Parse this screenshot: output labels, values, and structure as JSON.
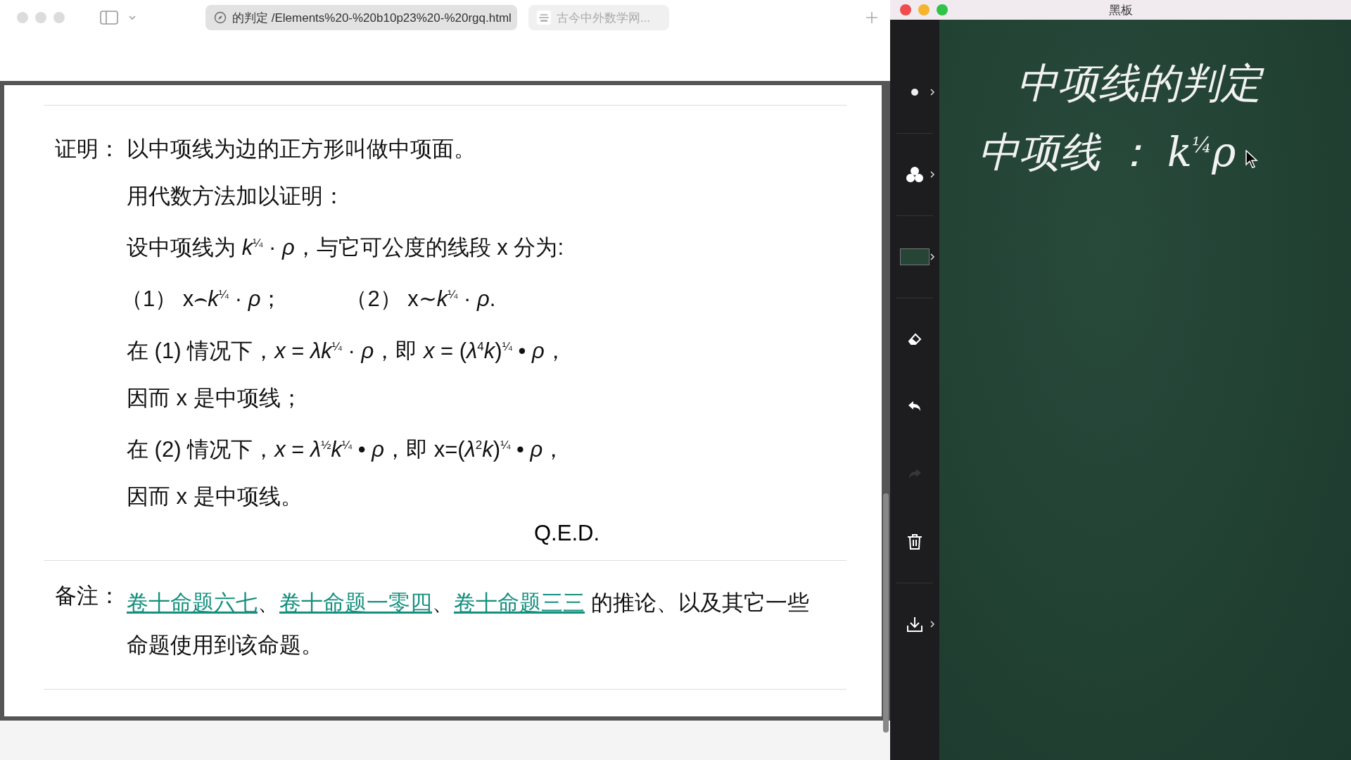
{
  "browser": {
    "tabs": [
      {
        "title": "的判定 /Elements%20-%20b10p23%20-%20rgq.html",
        "selected": true
      },
      {
        "title": "古今中外数学网...",
        "selected": false
      }
    ]
  },
  "page": {
    "proof": {
      "label": "证明：",
      "lines": [
        {
          "kind": "text",
          "text": "以中项线为边的正方形叫做中项面。"
        },
        {
          "kind": "text",
          "text": "用代数方法加以证明："
        },
        {
          "kind": "text",
          "text": "设中项线为 *k*$^{¼}$ · *ρ*，与它可公度的线段 x 分为:"
        },
        {
          "kind": "pair",
          "items": [
            "（1）  x⌢*k*$^{¼}$ · *ρ*；",
            "（2）  x∼*k*$^{¼}$ · *ρ*."
          ]
        },
        {
          "kind": "text",
          "text": "在 (1) 情况下，*x* = *λk*$^{¼}$ · *ρ*，即 *x* = (*λ*$^{4}$*k*)$^{¼}$ • *ρ*，"
        },
        {
          "kind": "text",
          "text": "因而 x 是中项线；"
        },
        {
          "kind": "text",
          "text": "在 (2) 情况下，*x* = *λ*$^{½}$*k*$^{¼}$ • *ρ*，即 x=(*λ*$^{2}$*k*)$^{¼}$ • *ρ*，"
        },
        {
          "kind": "text",
          "text": "因而 x 是中项线。"
        }
      ],
      "qed": "Q.E.D."
    },
    "note": {
      "label": "备注：",
      "segments": [
        {
          "kind": "link",
          "text": "卷十命题六七"
        },
        {
          "kind": "text",
          "text": "、"
        },
        {
          "kind": "link",
          "text": "卷十命题一零四"
        },
        {
          "kind": "text",
          "text": "、"
        },
        {
          "kind": "link",
          "text": "卷十命题三三"
        },
        {
          "kind": "text",
          "text": " 的推论、以及其它一些命题使用到该命题。"
        }
      ]
    }
  },
  "blackboard": {
    "title": "黑板",
    "tools": [
      {
        "kind": "dot",
        "disabled": false
      },
      {
        "kind": "colors",
        "disabled": false
      },
      {
        "kind": "swatch",
        "disabled": false
      },
      {
        "kind": "eraser",
        "disabled": false
      },
      {
        "kind": "undo",
        "disabled": false
      },
      {
        "kind": "redo",
        "disabled": true
      },
      {
        "kind": "trash",
        "disabled": false
      },
      {
        "kind": "download",
        "disabled": false
      }
    ],
    "writing": [
      "中项线的判定",
      "中项线 ： k$^{¼}$ρ"
    ]
  }
}
